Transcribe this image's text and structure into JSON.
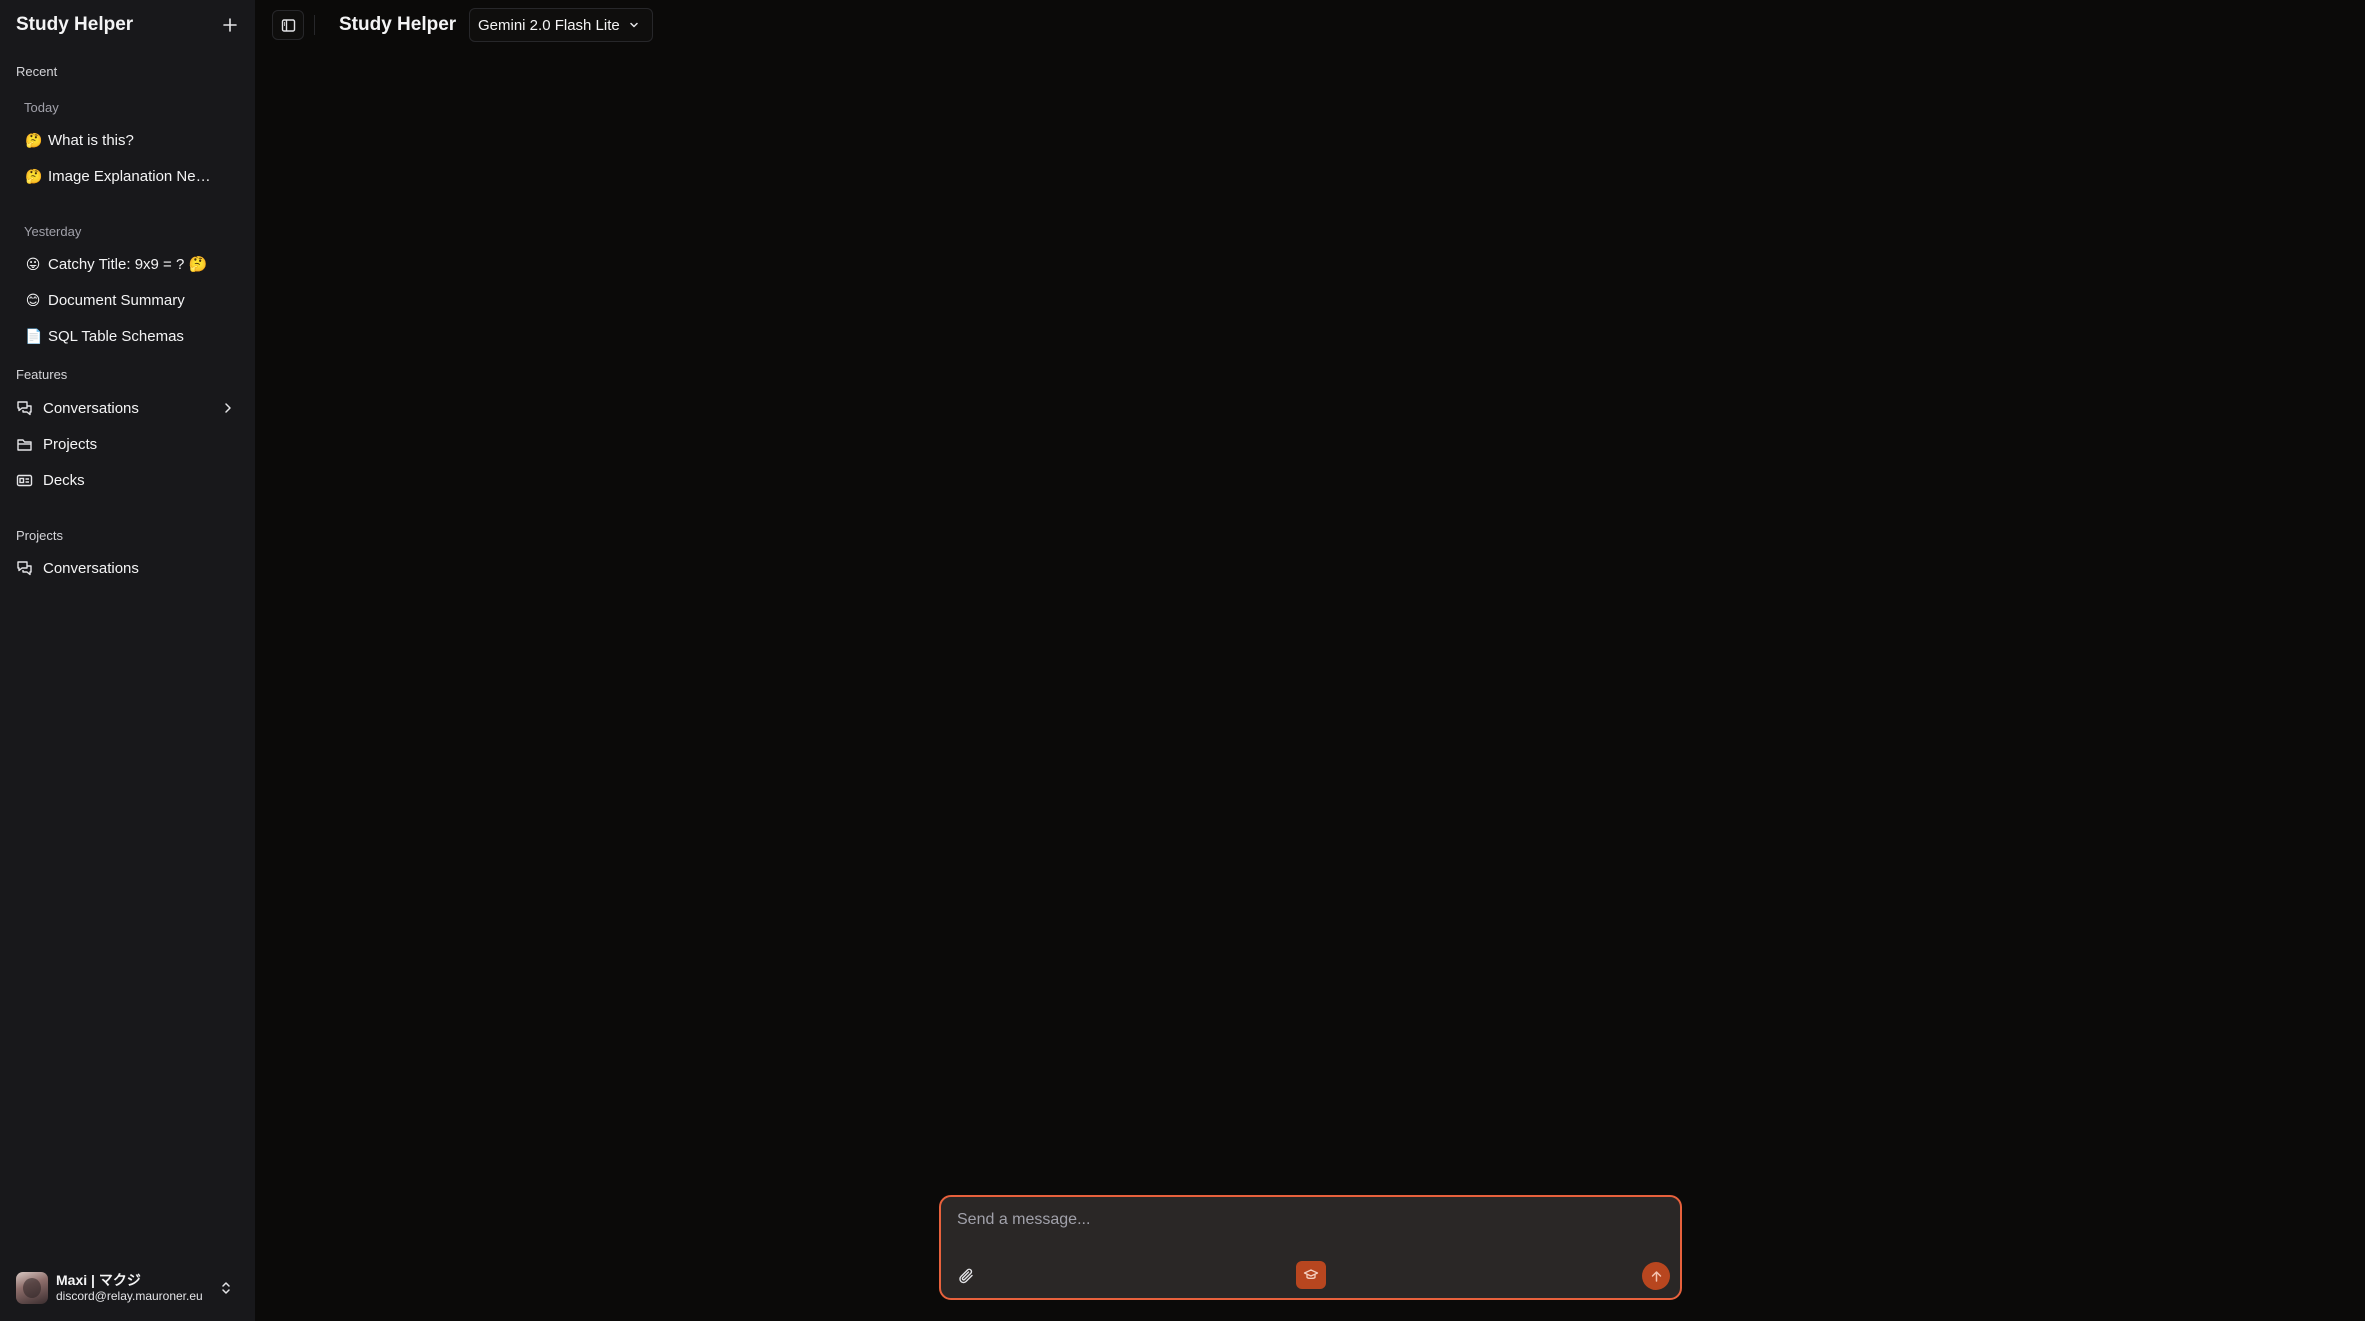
{
  "app": {
    "title": "Study Helper"
  },
  "sidebar": {
    "title": "Study Helper",
    "recent_label": "Recent",
    "groups": [
      {
        "label": "Today",
        "items": [
          {
            "emoji": "🤔",
            "title": "What is this?"
          },
          {
            "emoji": "🤔",
            "title": "Image Explanation Needed"
          }
        ]
      },
      {
        "label": "Yesterday",
        "items": [
          {
            "emoji": "😛",
            "title": "Catchy Title: 9x9 = ? 🤔"
          },
          {
            "emoji": "😊",
            "title": "Document Summary"
          },
          {
            "emoji": "📄",
            "title": "SQL Table Schemas"
          }
        ]
      }
    ],
    "features_label": "Features",
    "features": [
      {
        "label": "Conversations",
        "icon": "messages-icon"
      },
      {
        "label": "Projects",
        "icon": "folder-icon"
      },
      {
        "label": "Decks",
        "icon": "id-card-icon"
      }
    ],
    "projects_label": "Projects",
    "projects": [
      {
        "label": "Conversations",
        "icon": "messages-icon"
      }
    ],
    "user": {
      "name": "Maxi | マクジ",
      "email": "discord@relay.mauroner.eu"
    }
  },
  "header": {
    "title": "Study Helper",
    "model": "Gemini 2.0 Flash Lite"
  },
  "composer": {
    "placeholder": "Send a message..."
  },
  "colors": {
    "accent": "#e8613c",
    "accent_fill": "#b8461f",
    "sidebar_bg": "#18181b",
    "main_bg": "#0b0a09"
  }
}
